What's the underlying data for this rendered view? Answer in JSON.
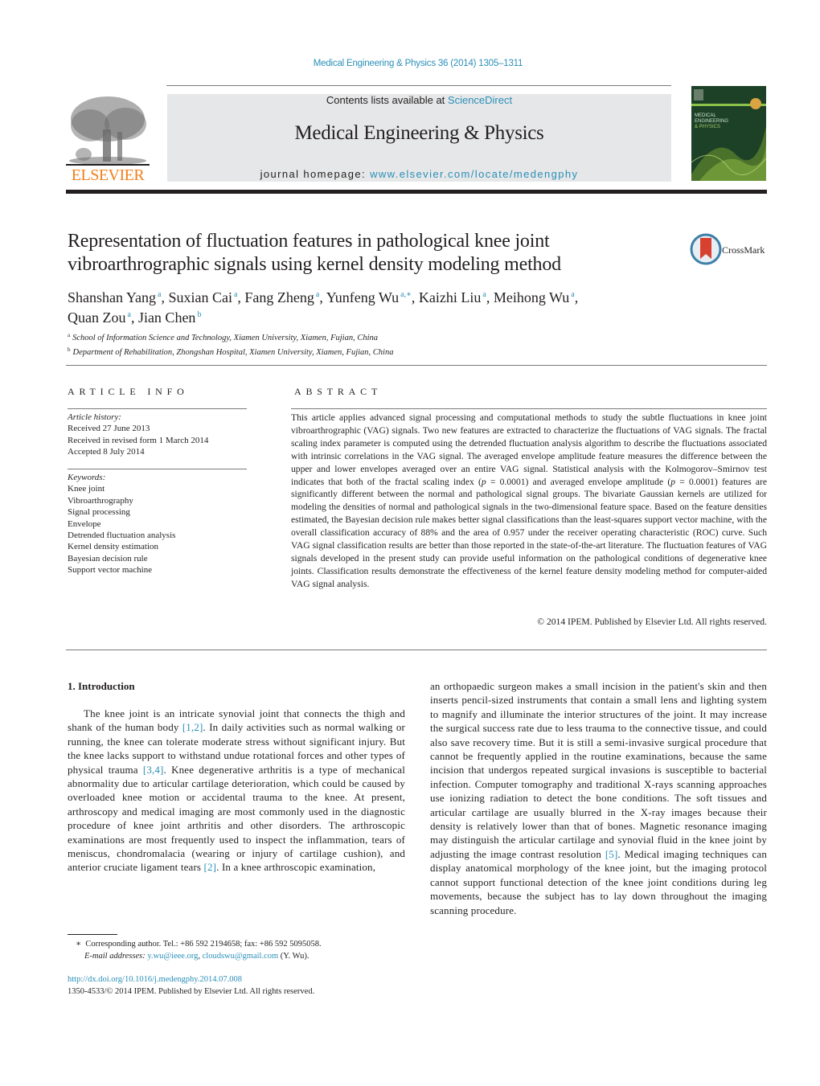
{
  "journal_citation": "Medical Engineering & Physics 36 (2014) 1305–1311",
  "header": {
    "publisher_logo_text": "ELSEVIER",
    "contents_prefix": "Contents lists available at ",
    "contents_link": "ScienceDirect",
    "journal_name": "Medical Engineering & Physics",
    "homepage_prefix": "journal homepage: ",
    "homepage_link": "www.elsevier.com/locate/medengphy",
    "cover_title_lines": [
      "MEDICAL",
      "ENGINEERING",
      "& PHYSICS"
    ]
  },
  "article": {
    "title": "Representation of fluctuation features in pathological knee joint vibroarthrographic signals using kernel density modeling method",
    "crossmark_label": "CrossMark",
    "authors": [
      {
        "name": "Shanshan Yang",
        "aff": "a"
      },
      {
        "name": "Suxian Cai",
        "aff": "a"
      },
      {
        "name": "Fang Zheng",
        "aff": "a"
      },
      {
        "name": "Yunfeng Wu",
        "aff": "a,∗"
      },
      {
        "name": "Kaizhi Liu",
        "aff": "a"
      },
      {
        "name": "Meihong Wu",
        "aff": "a"
      },
      {
        "name": "Quan Zou",
        "aff": "a"
      },
      {
        "name": "Jian Chen",
        "aff": "b"
      }
    ],
    "affiliations": [
      {
        "mark": "a",
        "text": "School of Information Science and Technology, Xiamen University, Xiamen, Fujian, China"
      },
      {
        "mark": "b",
        "text": "Department of Rehabilitation, Zhongshan Hospital, Xiamen University, Xiamen, Fujian, China"
      }
    ]
  },
  "article_info": {
    "heading": "ARTICLE INFO",
    "history_label": "Article history:",
    "history": [
      "Received 27 June 2013",
      "Received in revised form 1 March 2014",
      "Accepted 8 July 2014"
    ],
    "keywords_label": "Keywords:",
    "keywords": [
      "Knee joint",
      "Vibroarthrography",
      "Signal processing",
      "Envelope",
      "Detrended fluctuation analysis",
      "Kernel density estimation",
      "Bayesian decision rule",
      "Support vector machine"
    ]
  },
  "abstract": {
    "heading": "ABSTRACT",
    "text_1": "This article applies advanced signal processing and computational methods to study the subtle fluctuations in knee joint vibroarthrographic (VAG) signals. Two new features are extracted to characterize the fluctuations of VAG signals. The fractal scaling index parameter is computed using the detrended fluctuation analysis algorithm to describe the fluctuations associated with intrinsic correlations in the VAG signal. The averaged envelope amplitude feature measures the difference between the upper and lower envelopes averaged over an entire VAG signal. Statistical analysis with the Kolmogorov–Smirnov test indicates that both of the fractal scaling index (",
    "p_symbol": "p",
    "p_value_1": " = 0.0001) and averaged envelope amplitude (",
    "p_value_2": " = 0.0001) features are significantly different between the normal and pathological signal groups. The bivariate Gaussian kernels are utilized for modeling the densities of normal and pathological signals in the two-dimensional feature space. Based on the feature densities estimated, the Bayesian decision rule makes better signal classifications than the least-squares support vector machine, with the overall classification accuracy of 88% and the area of 0.957 under the receiver operating characteristic (ROC) curve. Such VAG signal classification results are better than those reported in the state-of-the-art literature. The fluctuation features of VAG signals developed in the present study can provide useful information on the pathological conditions of degenerative knee joints. Classification results demonstrate the effectiveness of the kernel feature density modeling method for computer-aided VAG signal analysis.",
    "copyright": "© 2014 IPEM. Published by Elsevier Ltd. All rights reserved."
  },
  "introduction": {
    "heading": "1.  Introduction",
    "left_segments": [
      {
        "t": "The knee joint is an intricate synovial joint that connects the thigh and shank of the human body "
      },
      {
        "t": "[1,2]",
        "ref": true
      },
      {
        "t": ". In daily activities such as normal walking or running, the knee can tolerate moderate stress without significant injury. But the knee lacks support to withstand undue rotational forces and other types of physical trauma "
      },
      {
        "t": "[3,4]",
        "ref": true
      },
      {
        "t": ". Knee degenerative arthritis is a type of mechanical abnormality due to articular cartilage deterioration, which could be caused by overloaded knee motion or accidental trauma to the knee. At present, arthroscopy and medical imaging are most commonly used in the diagnostic procedure of knee joint arthritis and other disorders. The arthroscopic examinations are most frequently used to inspect the inflammation, tears of meniscus, chondromalacia (wearing or injury of cartilage cushion), and anterior cruciate ligament tears "
      },
      {
        "t": "[2]",
        "ref": true
      },
      {
        "t": ". In a knee arthroscopic examination,"
      }
    ],
    "right_segments": [
      {
        "t": "an orthopaedic surgeon makes a small incision in the patient's skin and then inserts pencil-sized instruments that contain a small lens and lighting system to magnify and illuminate the interior structures of the joint. It may increase the surgical success rate due to less trauma to the connective tissue, and could also save recovery time. But it is still a semi-invasive surgical procedure that cannot be frequently applied in the routine examinations, because the same incision that undergos repeated surgical invasions is susceptible to bacterial infection. Computer tomography and traditional X-rays scanning approaches use ionizing radiation to detect the bone conditions. The soft tissues and articular cartilage are usually blurred in the X-ray images because their density is relatively lower than that of bones. Magnetic resonance imaging may distinguish the articular cartilage and synovial fluid in the knee joint by adjusting the image contrast resolution "
      },
      {
        "t": "[5]",
        "ref": true
      },
      {
        "t": ". Medical imaging techniques can display anatomical morphology of the knee joint, but the imaging protocol cannot support functional detection of the knee joint conditions during leg movements, because the subject has to lay down throughout the imaging scanning procedure."
      }
    ]
  },
  "footnote": {
    "star": "∗",
    "corresponding": "Corresponding author. Tel.: +86 592 2194658; fax: +86 592 5095058.",
    "email_label": "E-mail addresses:",
    "email_1": "y.wu@ieee.org",
    "email_sep": ", ",
    "email_2": "cloudswu@gmail.com",
    "email_owner": " (Y. Wu)."
  },
  "doi": {
    "link": "http://dx.doi.org/10.1016/j.medengphy.2014.07.008",
    "issn_line": "1350-4533/© 2014 IPEM. Published by Elsevier Ltd. All rights reserved."
  },
  "colors": {
    "link": "#2a8fb8",
    "elsevier_orange": "#f07f1c",
    "header_box": "#e6e7e8",
    "cover_green": "#1d4127"
  }
}
